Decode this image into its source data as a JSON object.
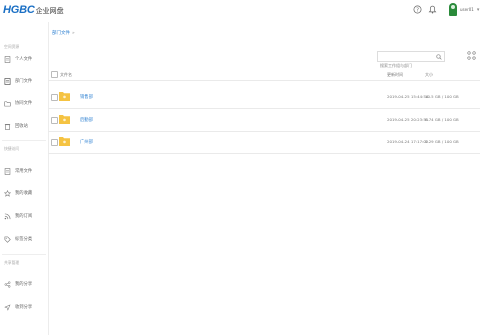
{
  "app": {
    "brand": "HGBC",
    "name": "企业网盘"
  },
  "user": {
    "name": "user01"
  },
  "breadcrumb": {
    "current": "部门文件",
    "separator": "»"
  },
  "sidebar": {
    "section1": "空间资源",
    "section1_items": [
      "个人文件",
      "部门文件",
      "协同文件",
      "回收站"
    ],
    "section2": "快捷访问",
    "section2_items": [
      "常用文件",
      "我的收藏",
      "我的订阅",
      "标签分类"
    ],
    "section3": "共享管理",
    "section3_items": [
      "我的分享",
      "收到分享"
    ]
  },
  "search": {
    "placeholder": "搜索工作组与部门"
  },
  "table": {
    "headers": {
      "name": "文件名",
      "time": "更新时间",
      "size": "大小"
    },
    "rows": [
      {
        "name": "销售部",
        "time": "2019-04-25 15:44:54",
        "size": "10.5 GB / 100 GB"
      },
      {
        "name": "后勤部",
        "time": "2019-04-25 20:23:51",
        "size": "8.74 GB / 100 GB"
      },
      {
        "name": "广州部",
        "time": "2019-04-24 17:17:02",
        "size": "5.29 GB / 100 GB"
      }
    ]
  },
  "colors": {
    "accent": "#2b7fd1",
    "brand": "#1a6fc4",
    "folder": "#f5c342"
  }
}
